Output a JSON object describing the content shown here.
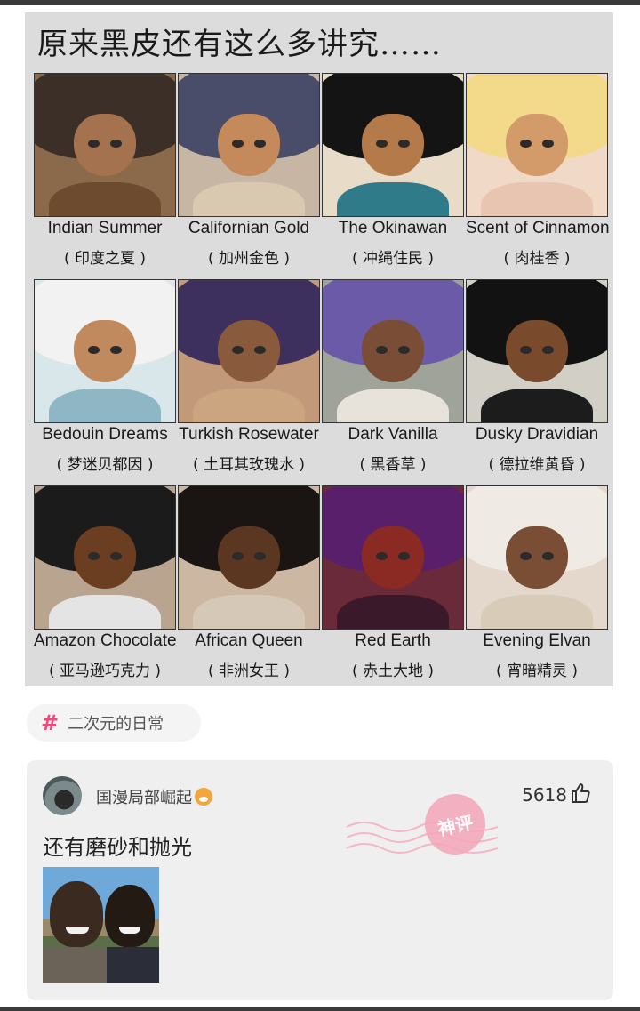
{
  "post": {
    "image_title": "原来黑皮还有这么多讲究……",
    "cells": [
      {
        "en": "Indian Summer",
        "cn": "( 印度之夏 )",
        "colors": {
          "bg": "#8a6a4a",
          "hair": "#3b2f28",
          "skin": "#a5724f",
          "body": "#6d4b2e"
        }
      },
      {
        "en": "Californian Gold",
        "cn": "( 加州金色 )",
        "colors": {
          "bg": "#c7b6a4",
          "hair": "#4a4d6a",
          "skin": "#c48a5c",
          "body": "#d9c9b0"
        }
      },
      {
        "en": "The Okinawan",
        "cn": "( 冲绳住民 )",
        "colors": {
          "bg": "#e8dcc8",
          "hair": "#141414",
          "skin": "#b57a4a",
          "body": "#2f7b8a"
        }
      },
      {
        "en": "Scent of Cinnamon",
        "cn": "( 肉桂香 )",
        "colors": {
          "bg": "#f1d9c8",
          "hair": "#f3d98a",
          "skin": "#d39a6a",
          "body": "#e8c5b0"
        }
      },
      {
        "en": "Bedouin Dreams",
        "cn": "( 梦迷贝都因 )",
        "colors": {
          "bg": "#d9e6ea",
          "hair": "#f2f2f2",
          "skin": "#c08a5e",
          "body": "#8fb6c4"
        }
      },
      {
        "en": "Turkish Rosewater",
        "cn": "( 土耳其玫瑰水 )",
        "colors": {
          "bg": "#c29a7a",
          "hair": "#3d2f5e",
          "skin": "#8a5a3c",
          "body": "#caa57f"
        }
      },
      {
        "en": "Dark Vanilla",
        "cn": "( 黑香草 )",
        "colors": {
          "bg": "#9fa39a",
          "hair": "#6a5aa8",
          "skin": "#7a4e36",
          "body": "#e7e3da"
        }
      },
      {
        "en": "Dusky Dravidian",
        "cn": "( 德拉维黄昏 )",
        "colors": {
          "bg": "#d2cfc6",
          "hair": "#121212",
          "skin": "#7a4a2c",
          "body": "#1c1c1c"
        }
      },
      {
        "en": "Amazon Chocolate",
        "cn": "( 亚马逊巧克力 )",
        "colors": {
          "bg": "#b8a48f",
          "hair": "#1b1b1b",
          "skin": "#6b3e22",
          "body": "#e4e4e4"
        }
      },
      {
        "en": "African Queen",
        "cn": "( 非洲女王 )",
        "colors": {
          "bg": "#ccb8a2",
          "hair": "#1a1512",
          "skin": "#5b3620",
          "body": "#d6c8b6"
        }
      },
      {
        "en": "Red Earth",
        "cn": "( 赤土大地 )",
        "colors": {
          "bg": "#6a2a3a",
          "hair": "#5a1f6a",
          "skin": "#8a2a22",
          "body": "#3a1a2a"
        }
      },
      {
        "en": "Evening Elvan",
        "cn": "( 宵暗精灵 )",
        "colors": {
          "bg": "#e3d8cb",
          "hair": "#efeae3",
          "skin": "#7a4e34",
          "body": "#d8cbb8"
        }
      }
    ]
  },
  "tag": {
    "icon": "#",
    "label": "二次元的日常"
  },
  "comment": {
    "username": "国漫局部崛起",
    "likes": "5618",
    "text": "还有磨砂和抛光",
    "stamp": "神评"
  }
}
